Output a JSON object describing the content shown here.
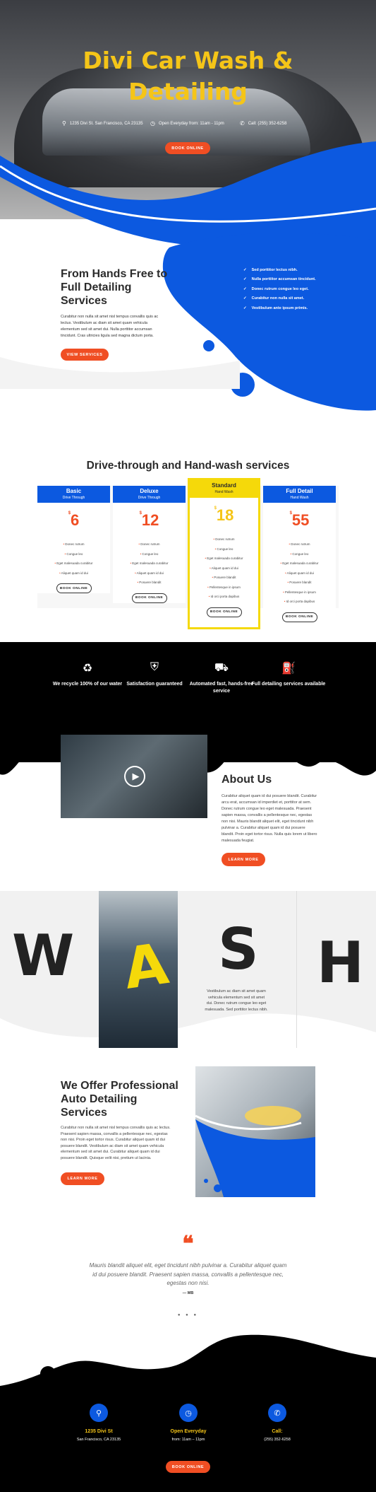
{
  "hero": {
    "title_line1": "Divi Car Wash &",
    "title_line2": "Detailing",
    "address": "1235 Divi St. San Francisco, CA 23135",
    "hours": "Open Everyday from: 11am - 11pm",
    "phone": "Call: (255) 352-6258",
    "button": "BOOK ONLINE"
  },
  "intro": {
    "title": "From Hands Free to Full Detailing Services",
    "text": "Curabitur non nulla sit amet nisl tempus convallis quis ac lectus. Vestibulum ac diam sit amet quam vehicula elementum sed sit amet dui. Nulla porttitor accumsan tincidunt. Cras ultricies ligula sed magna dictum porta.",
    "button": "VIEW SERVICES",
    "checks": [
      "Sed porttitor lectus nibh.",
      "Nulla porttitor accumsan tincidunt.",
      "Donec rutrum congue leo eget.",
      "Curabitur non nulla sit amet.",
      "Vestibulum ante ipsum primis."
    ]
  },
  "pricing": {
    "title": "Drive-through and Hand-wash services",
    "currency": "$",
    "book": "BOOK ONLINE",
    "plans": [
      {
        "name": "Basic",
        "sub": "Drive Through",
        "price": "6",
        "features": [
          "Donec rutrum",
          "Congue leo",
          "Eget malesuada curabitur",
          "Aliquet quam id dui"
        ]
      },
      {
        "name": "Deluxe",
        "sub": "Drive Through",
        "price": "12",
        "features": [
          "Donec rutrum",
          "Congue leo",
          "Eget malesuada curabitur",
          "Aliquet quam id dui",
          "Posuere blandit"
        ]
      },
      {
        "name": "Standard",
        "sub": "Hand Wash",
        "price": "18",
        "features": [
          "Donec rutrum",
          "Congue leo",
          "Eget malesuada curabitur",
          "Aliquet quam id dui",
          "Posuere blandit",
          "Pellentesque in ipsum",
          "Id orci porta dapibus"
        ]
      },
      {
        "name": "Full Detail",
        "sub": "Hand Wash",
        "price": "55",
        "features": [
          "Donec rutrum",
          "Congue leo",
          "Eget malesuada curabitur",
          "Aliquet quam id dui",
          "Posuere blandit",
          "Pellentesque in ipsum",
          "Id orci porta dapibus"
        ]
      }
    ]
  },
  "features": [
    {
      "icon": "recycle-icon",
      "label": "We recycle 100% of our water"
    },
    {
      "icon": "shield-icon",
      "label": "Satisfaction guaranteed"
    },
    {
      "icon": "car-wash-icon",
      "label": "Automated fast, hands-free service"
    },
    {
      "icon": "detailing-icon",
      "label": "Full detailing services available"
    }
  ],
  "about": {
    "title": "About Us",
    "text": "Curabitur aliquet quam id dui posuere blandit. Curabitur arcu erat, accumsan id imperdiet et, porttitor at sem. Donec rutrum congue leo eget malesuada. Praesent sapien massa, convallis a pellentesque nec, egestas non nisi. Mauris blandit aliquet elit, eget tincidunt nibh pulvinar a. Curabitur aliquet quam id dui posuere blandit. Proin eget tortor risus. Nulla quis lorem ut libero malesuada feugiat.",
    "button": "LEARN MORE"
  },
  "wash": {
    "letters": [
      "W",
      "A",
      "S",
      "H"
    ],
    "text": "Vestibulum ac diam sit amet quam vehicula elementum sed sit amet dui. Donec rutrum congue leo eget malesuada. Sed porttitor lectus nibh."
  },
  "services": {
    "title": "We Offer Professional Auto Detailing Services",
    "text": "Curabitur non nulla sit amet nisl tempus convallis quis ac lectus. Praesent sapien massa, convallis a pellentesque nec, egestas non nisi. Proin eget tortor risus. Curabitur aliquet quam id dui posuere blandit. Vestibulum ac diam sit amet quam vehicula elementum sed sit amet dui. Curabitur aliquet quam id dui posuere blandit. Quisque velit nisi, pretium ut lacinia.",
    "button": "LEARN MORE"
  },
  "testimonial": {
    "quote": "Mauris blandit aliquet elit, eget tincidunt nibh pulvinar a. Curabitur aliquet quam id dui posuere blandit. Praesent sapien massa, convallis a pellentesque nec, egestas non nisi.",
    "author": "— MB"
  },
  "footer": {
    "cols": [
      {
        "icon": "location-icon",
        "title": "1235 Divi St",
        "sub": "San Francisco, CA 23135"
      },
      {
        "icon": "clock-icon",
        "title": "Open Everyday",
        "sub": "from: 11am – 11pm"
      },
      {
        "icon": "phone-icon",
        "title": "Call:",
        "sub": "(255) 352-6258"
      }
    ],
    "button": "BOOK ONLINE"
  },
  "colors": {
    "accent": "#f04e23",
    "blue": "#0c59e0",
    "yellow": "#f5c518"
  }
}
